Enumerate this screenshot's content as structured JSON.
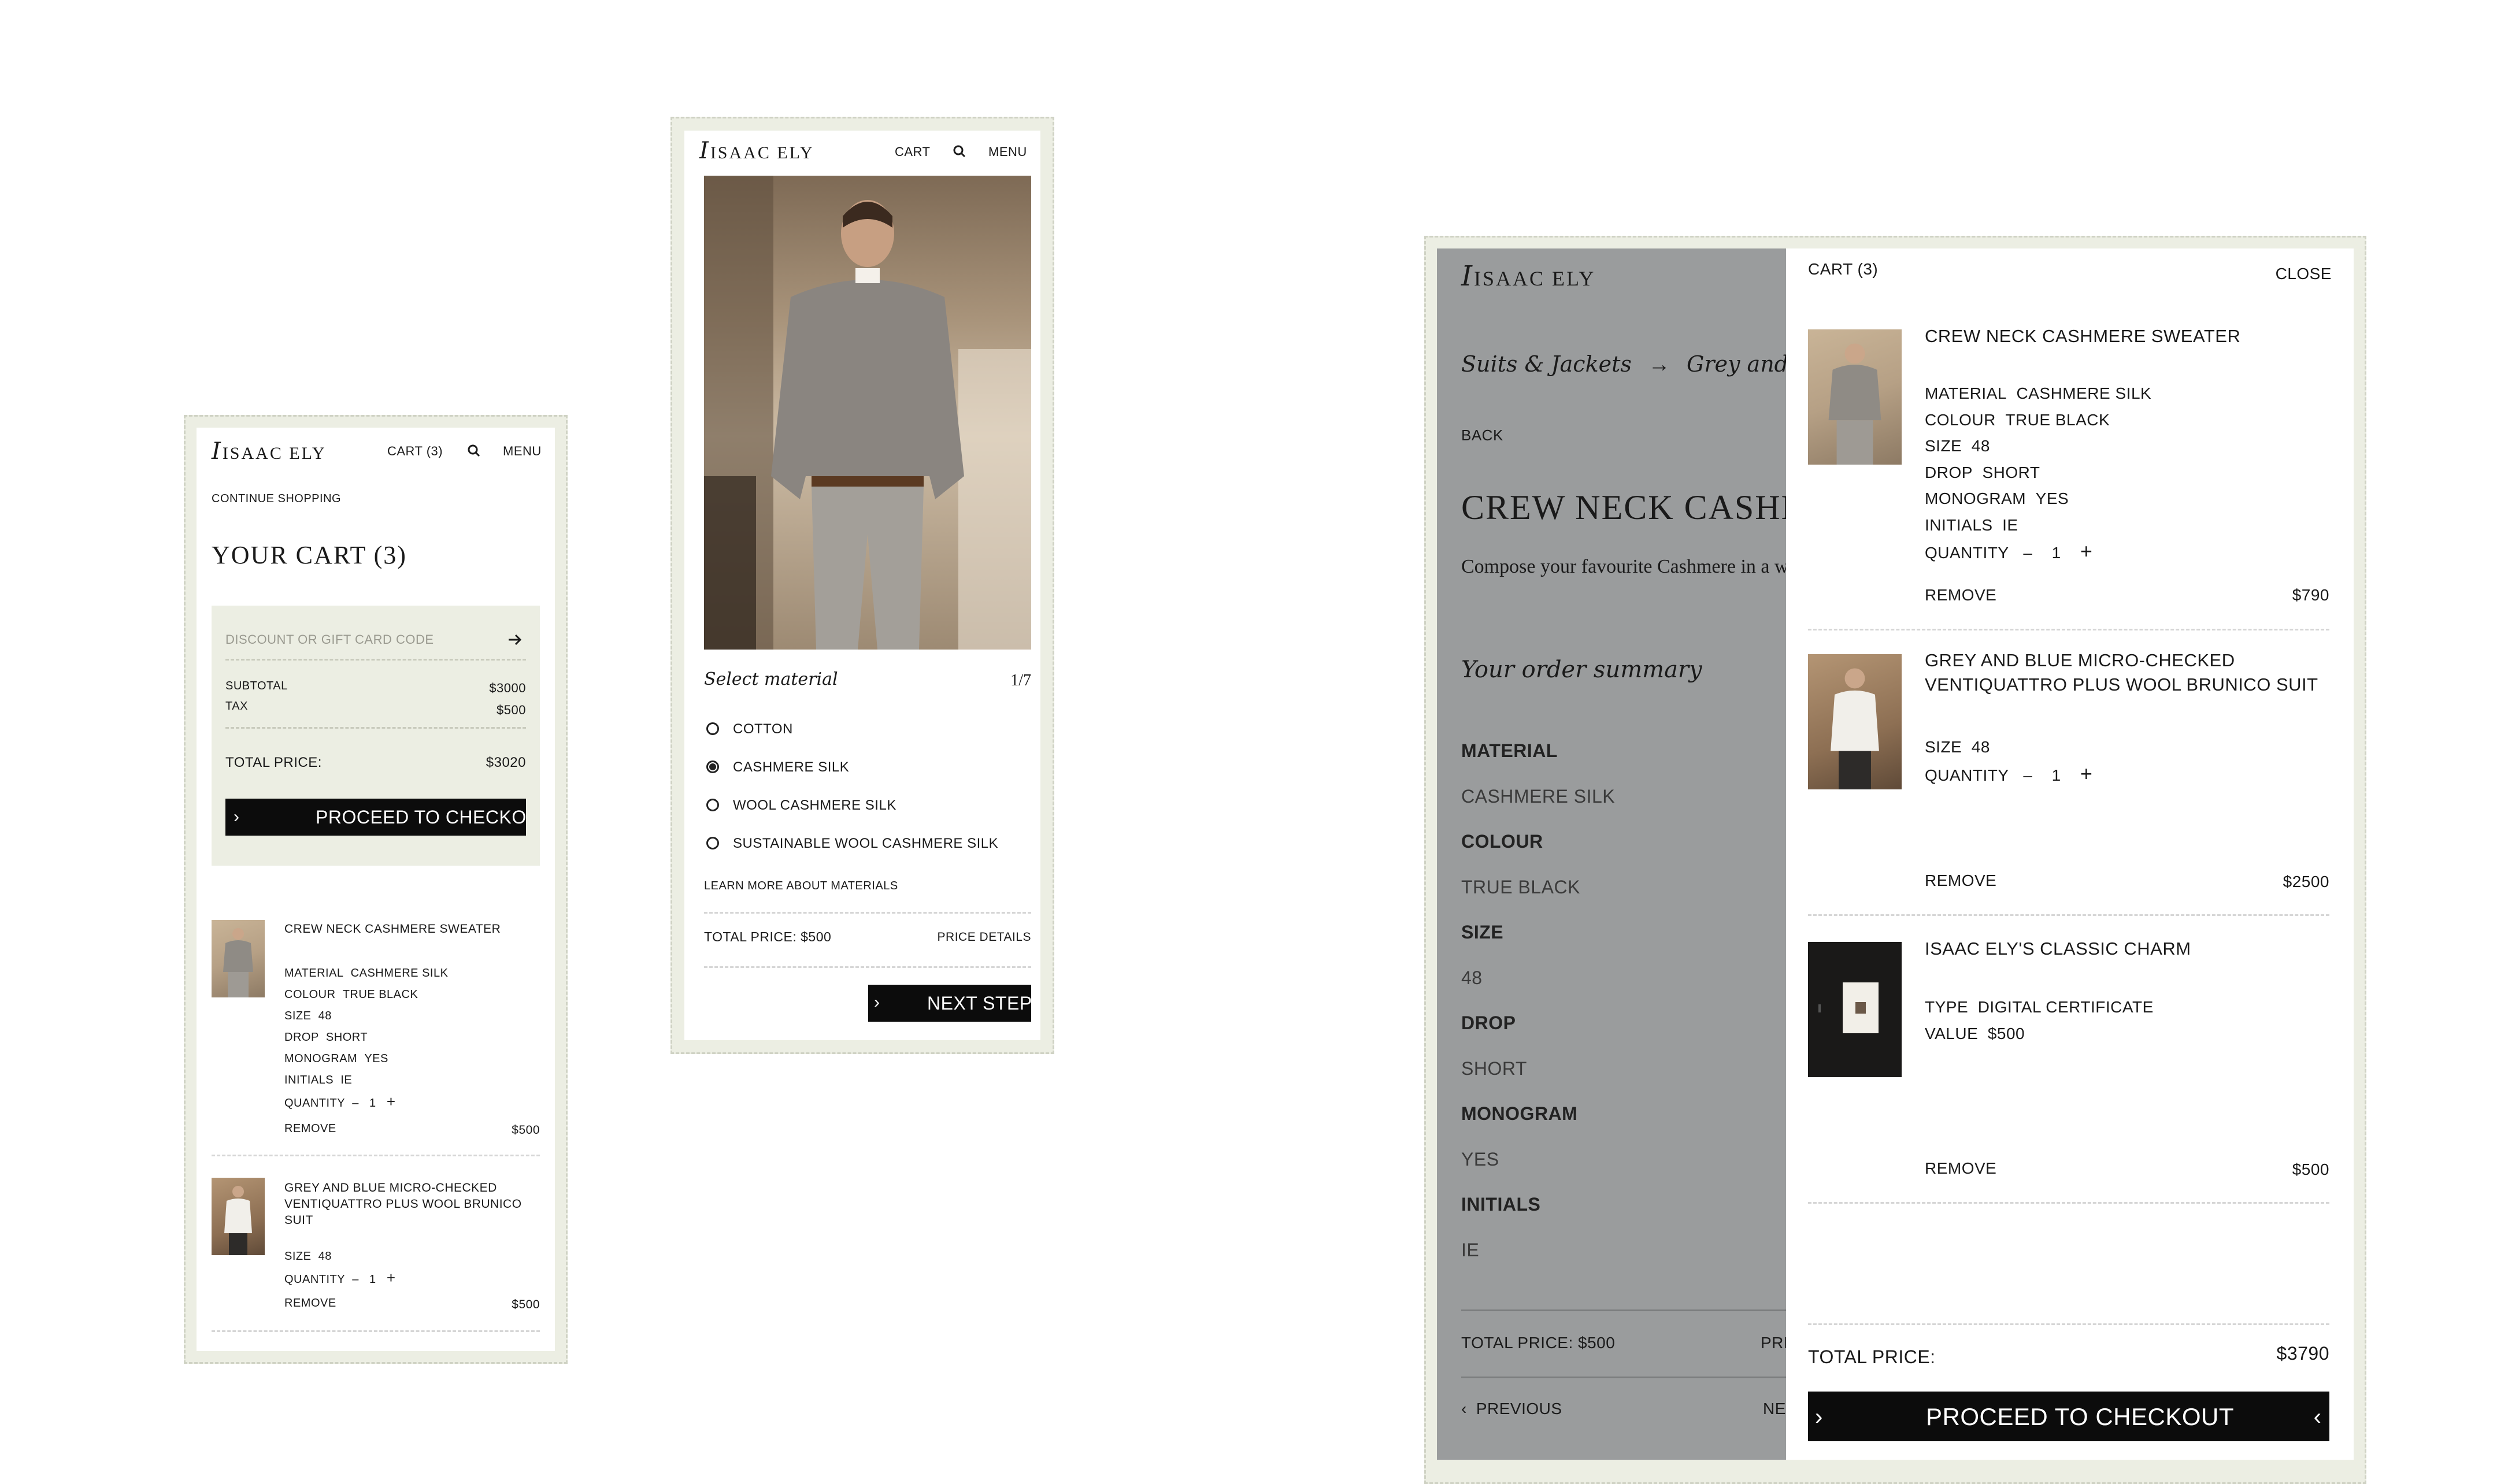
{
  "brand": {
    "logo_letter": "I",
    "logo_text": "ISAAC ELY"
  },
  "header": {
    "cart_label": "CART (3)",
    "cart_short": "CART",
    "menu_label": "MENU"
  },
  "cart_page": {
    "continue_shopping": "CONTINUE SHOPPING",
    "title": "YOUR CART (3)",
    "discount_placeholder": "DISCOUNT OR GIFT CARD CODE",
    "subtotal_label": "SUBTOTAL",
    "subtotal_value": "$3000",
    "tax_label": "TAX",
    "tax_value": "$500",
    "total_label": "TOTAL PRICE:",
    "total_value": "$3020",
    "checkout_button": "PROCEED TO CHECKOUT",
    "items": [
      {
        "name": "CREW NECK CASHMERE SWEATER",
        "attrs": [
          [
            "MATERIAL",
            "CASHMERE SILK"
          ],
          [
            "COLOUR",
            "TRUE BLACK"
          ],
          [
            "SIZE",
            "48"
          ],
          [
            "DROP",
            "SHORT"
          ],
          [
            "MONOGRAM",
            "YES"
          ],
          [
            "INITIALS",
            "IE"
          ]
        ],
        "quantity_label": "QUANTITY",
        "quantity": "1",
        "remove": "REMOVE",
        "price": "$500"
      },
      {
        "name": "GREY AND BLUE MICRO-CHECKED VENTIQUATTRO PLUS WOOL BRUNICO SUIT",
        "attrs": [
          [
            "SIZE",
            "48"
          ]
        ],
        "quantity_label": "QUANTITY",
        "quantity": "1",
        "remove": "REMOVE",
        "price": "$500"
      }
    ]
  },
  "product_page": {
    "select_material": "Select material",
    "step": "1/7",
    "options": [
      {
        "label": "COTTON",
        "selected": false
      },
      {
        "label": "CASHMERE SILK",
        "selected": true
      },
      {
        "label": "WOOL CASHMERE SILK",
        "selected": false
      },
      {
        "label": "SUSTAINABLE WOOL CASHMERE SILK",
        "selected": false
      }
    ],
    "learn_more": "LEARN MORE ABOUT MATERIALS",
    "total_price": "TOTAL PRICE: $500",
    "price_details": "PRICE DETAILS",
    "next_step": "NEXT STEP"
  },
  "drawer_page": {
    "breadcrumb_1": "Suits & Jackets",
    "breadcrumb_2": "Grey and blue micro-checked",
    "back": "BACK",
    "product_title": "CREW NECK CASHMERE SWEATER",
    "description": "Compose your favourite Cashmere in a way that suits you.",
    "summary_title": "Your order summary",
    "summary": [
      [
        "MATERIAL",
        "CASHMERE SILK"
      ],
      [
        "COLOUR",
        "TRUE BLACK"
      ],
      [
        "SIZE",
        "48"
      ],
      [
        "DROP",
        "SHORT"
      ],
      [
        "MONOGRAM",
        "YES"
      ],
      [
        "INITIALS",
        "IE"
      ]
    ],
    "total_price": "TOTAL PRICE: $500",
    "price_details": "PRICE DETAILS",
    "previous": "PREVIOUS",
    "next": "NEXT STEP",
    "drawer": {
      "title": "CART (3)",
      "close": "CLOSE",
      "items": [
        {
          "name": "CREW NECK CASHMERE SWEATER",
          "attrs": [
            [
              "MATERIAL",
              "CASHMERE SILK"
            ],
            [
              "COLOUR",
              "TRUE BLACK"
            ],
            [
              "SIZE",
              "48"
            ],
            [
              "DROP",
              "SHORT"
            ],
            [
              "MONOGRAM",
              "YES"
            ],
            [
              "INITIALS",
              "IE"
            ]
          ],
          "quantity_label": "QUANTITY",
          "quantity": "1",
          "remove": "REMOVE",
          "price": "$790"
        },
        {
          "name": "GREY AND BLUE MICRO-CHECKED VENTIQUATTRO PLUS WOOL BRUNICO SUIT",
          "attrs": [
            [
              "SIZE",
              "48"
            ]
          ],
          "quantity_label": "QUANTITY",
          "quantity": "1",
          "remove": "REMOVE",
          "price": "$2500"
        },
        {
          "name": "ISAAC ELY'S CLASSIC CHARM",
          "attrs": [
            [
              "TYPE",
              "DIGITAL CERTIFICATE"
            ],
            [
              "VALUE",
              "$500"
            ]
          ],
          "remove": "REMOVE",
          "price": "$500"
        }
      ],
      "total_label": "TOTAL PRICE:",
      "total_value": "$3790",
      "checkout_button": "PROCEED TO CHECKOUT"
    }
  }
}
